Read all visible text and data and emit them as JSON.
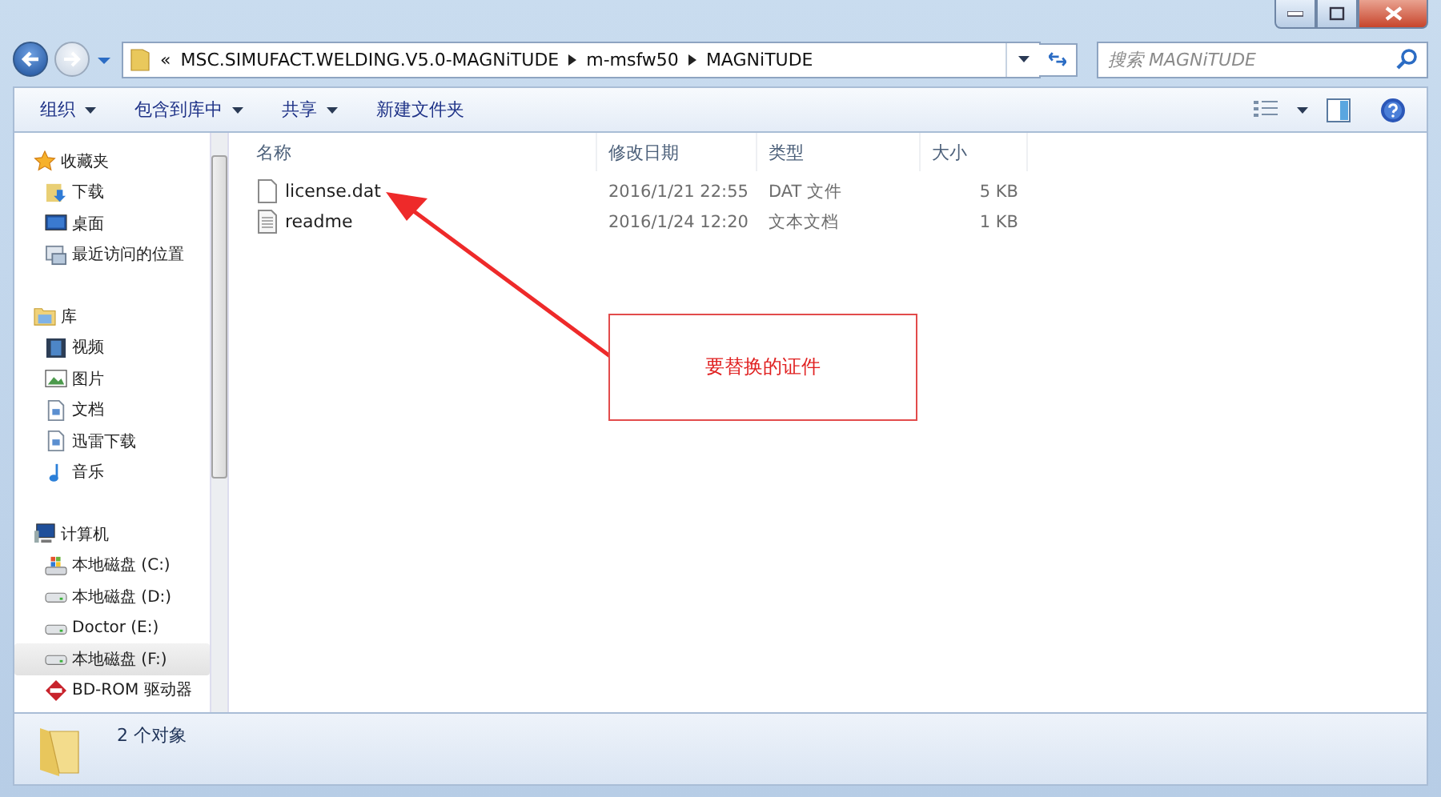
{
  "address": {
    "overflow": "«",
    "crumbs": [
      "MSC.SIMUFACT.WELDING.V5.0-MAGNiTUDE",
      "m-msfw50",
      "MAGNiTUDE"
    ]
  },
  "search": {
    "placeholder": "搜索 MAGNiTUDE"
  },
  "toolbar": [
    {
      "label": "组织",
      "has_menu": true
    },
    {
      "label": "包含到库中",
      "has_menu": true
    },
    {
      "label": "共享",
      "has_menu": true
    },
    {
      "label": "新建文件夹",
      "has_menu": false
    }
  ],
  "sidebar": {
    "groups": [
      {
        "label": "收藏夹",
        "kind": "star",
        "children": [
          {
            "label": "下载",
            "kind": "download",
            "selected": false
          },
          {
            "label": "桌面",
            "kind": "desktop",
            "selected": false
          },
          {
            "label": "最近访问的位置",
            "kind": "recent",
            "selected": false
          }
        ]
      },
      {
        "label": "库",
        "kind": "library",
        "children": [
          {
            "label": "视频",
            "kind": "video",
            "selected": false
          },
          {
            "label": "图片",
            "kind": "picture",
            "selected": false
          },
          {
            "label": "文档",
            "kind": "document",
            "selected": false
          },
          {
            "label": "迅雷下载",
            "kind": "document",
            "selected": false
          },
          {
            "label": "音乐",
            "kind": "music",
            "selected": false
          }
        ]
      },
      {
        "label": "计算机",
        "kind": "computer",
        "children": [
          {
            "label": "本地磁盘 (C:)",
            "kind": "system",
            "selected": false
          },
          {
            "label": "本地磁盘 (D:)",
            "kind": "drive",
            "selected": false
          },
          {
            "label": "Doctor (E:)",
            "kind": "drive",
            "selected": false
          },
          {
            "label": "本地磁盘 (F:)",
            "kind": "drive",
            "selected": true
          },
          {
            "label": "BD-ROM 驱动器",
            "kind": "disc",
            "selected": false
          }
        ]
      }
    ]
  },
  "table": {
    "columns": [
      "名称",
      "修改日期",
      "类型",
      "大小"
    ],
    "rows": [
      {
        "name": "license.dat",
        "modified": "2016/1/21 22:55",
        "type": "DAT 文件",
        "size": "5 KB",
        "kind": "blank"
      },
      {
        "name": "readme",
        "modified": "2016/1/24 12:20",
        "type": "文本文档",
        "size": "1 KB",
        "kind": "text"
      }
    ]
  },
  "annotation": {
    "text": "要替换的证件"
  },
  "status_bar": {
    "text": "2 个对象"
  }
}
